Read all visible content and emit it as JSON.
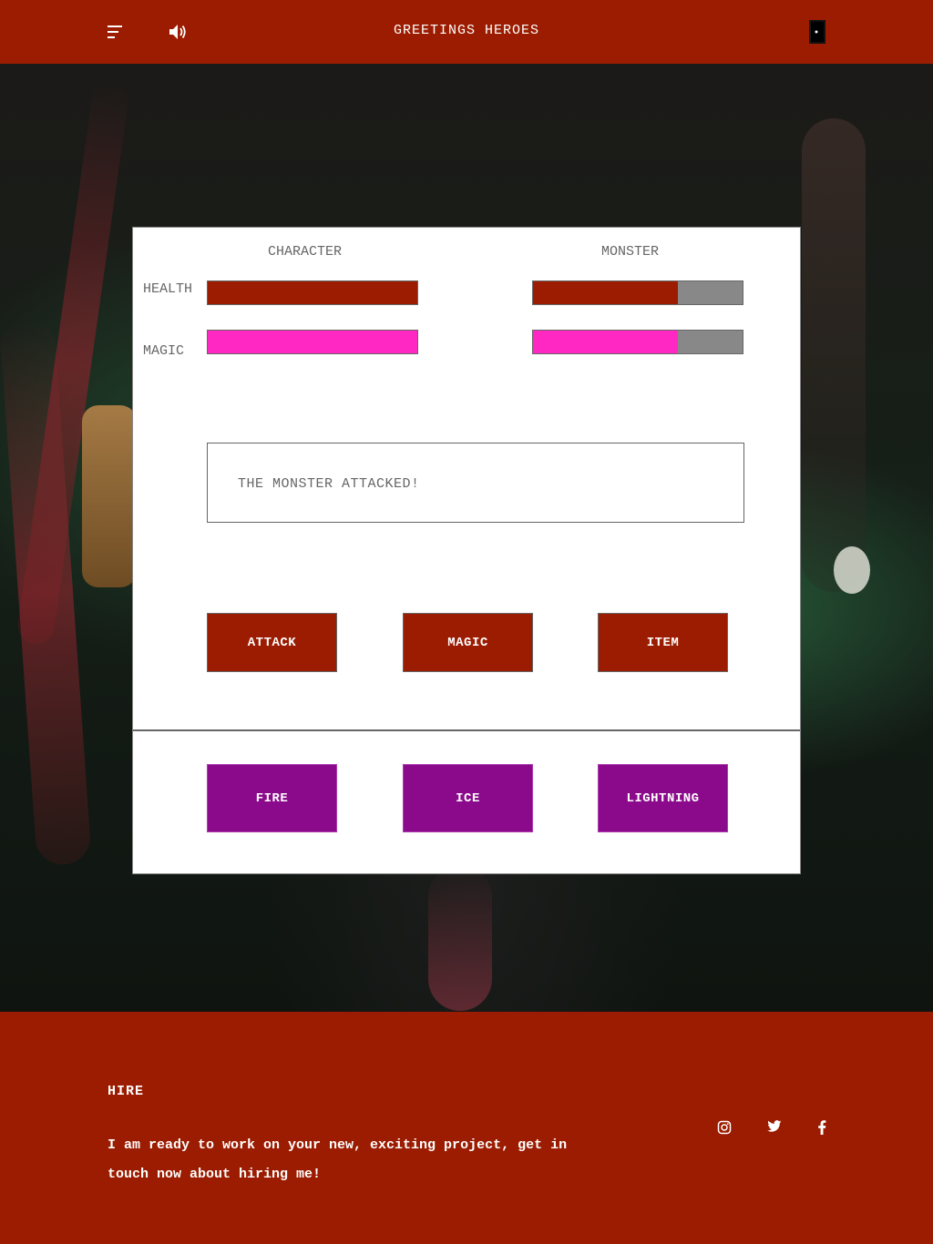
{
  "header": {
    "title": "GREETINGS HEROES",
    "menu_icon": "hamburger-menu-icon",
    "sound_icon": "speaker-volume-icon",
    "exit_icon": "door-exit-icon"
  },
  "battle": {
    "character_title": "CHARACTER",
    "monster_title": "MONSTER",
    "health_label": "HEALTH",
    "magic_label": "MAGIC",
    "character": {
      "health_percent": 100,
      "magic_percent": 100
    },
    "monster": {
      "health_percent": 69,
      "magic_percent": 69
    },
    "message": "THE MONSTER ATTACKED!",
    "actions": {
      "attack": "ATTACK",
      "magic": "MAGIC",
      "item": "ITEM"
    },
    "spells": {
      "fire": "FIRE",
      "ice": "ICE",
      "lightning": "LIGHTNING"
    }
  },
  "footer": {
    "heading": "HIRE",
    "text": "I am ready to work on your new, exciting project, get in touch now about hiring me!",
    "social_icons": [
      "instagram-icon",
      "twitter-icon",
      "facebook-icon"
    ]
  },
  "colors": {
    "brand_red": "#9b1c00",
    "health_fill": "#9b1c00",
    "magic_fill": "#ff28c2",
    "spell_purple": "#8b0a8b",
    "bar_empty": "#888888"
  }
}
